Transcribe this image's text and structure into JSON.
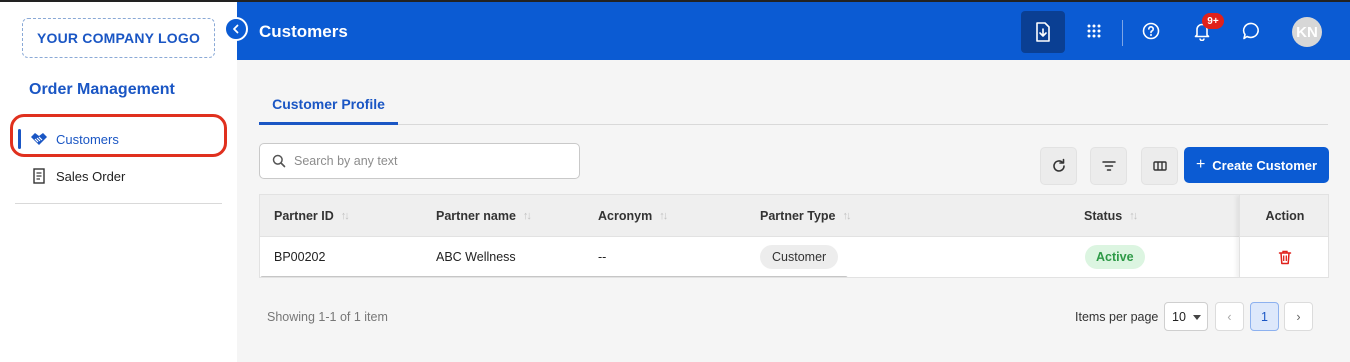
{
  "sidebar": {
    "logo_text": "YOUR COMPANY LOGO",
    "module_title": "Order Management",
    "items": [
      {
        "label": "Customers",
        "icon": "handshake-icon",
        "active": true
      },
      {
        "label": "Sales Order",
        "icon": "receipt-icon",
        "active": false
      }
    ]
  },
  "header": {
    "title": "Customers",
    "notification_badge": "9+",
    "avatar_initials": "KN",
    "icons": [
      "download-icon",
      "apps-grid-icon",
      "help-icon",
      "bell-icon",
      "chat-icon"
    ]
  },
  "tabs": [
    {
      "label": "Customer Profile",
      "active": true
    }
  ],
  "toolbar": {
    "search_placeholder": "Search by any text",
    "create_label": "Create Customer"
  },
  "table": {
    "columns": [
      "Partner ID",
      "Partner name",
      "Acronym",
      "Partner Type",
      "Status",
      "Action"
    ],
    "rows": [
      {
        "partner_id": "BP00202",
        "partner_name": "ABC Wellness",
        "acronym": "--",
        "partner_type": "Customer",
        "status": "Active"
      }
    ]
  },
  "footer": {
    "showing": "Showing 1-1 of 1 item",
    "items_per_page_label": "Items per page",
    "items_per_page_value": "10",
    "current_page": "1",
    "prev_symbol": "‹",
    "next_symbol": "›"
  },
  "colors": {
    "primary": "#0b5bd3",
    "active_status": "#2e9a47",
    "delete": "#e0211b",
    "highlight": "#e0301e"
  }
}
